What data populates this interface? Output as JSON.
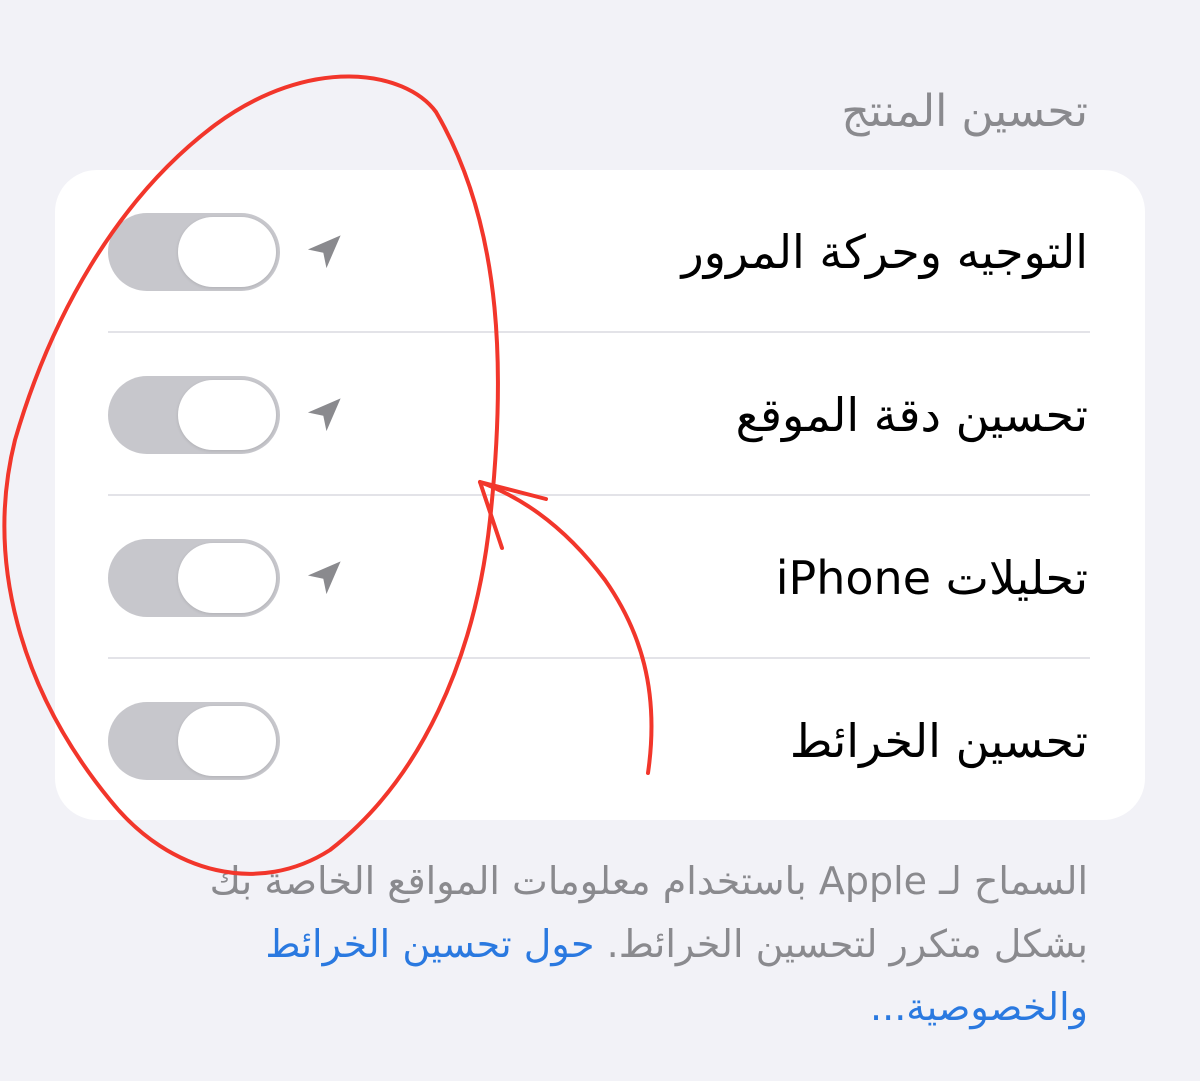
{
  "section": {
    "title": "تحسين المنتج"
  },
  "rows": [
    {
      "label": "التوجيه وحركة المرور",
      "icon": "location-arrow-icon",
      "toggle_on": false
    },
    {
      "label": "تحسين دقة الموقع",
      "icon": "location-arrow-icon",
      "toggle_on": false
    },
    {
      "label": "تحليلات iPhone",
      "icon": "location-arrow-icon",
      "toggle_on": false
    },
    {
      "label": "تحسين الخرائط",
      "toggle_on": false
    }
  ],
  "footer": {
    "text": "السماح لـ Apple باستخدام معلومات المواقع الخاصة بك بشكل متكرر لتحسين الخرائط. ",
    "link": "حول تحسين الخرائط والخصوصية..."
  },
  "colors": {
    "background": "#f2f2f7",
    "card": "#ffffff",
    "toggle_off": "#c7c7cc",
    "secondary_text": "#8a8a8e",
    "link": "#2a79e0",
    "annotation": "#f2362b"
  }
}
